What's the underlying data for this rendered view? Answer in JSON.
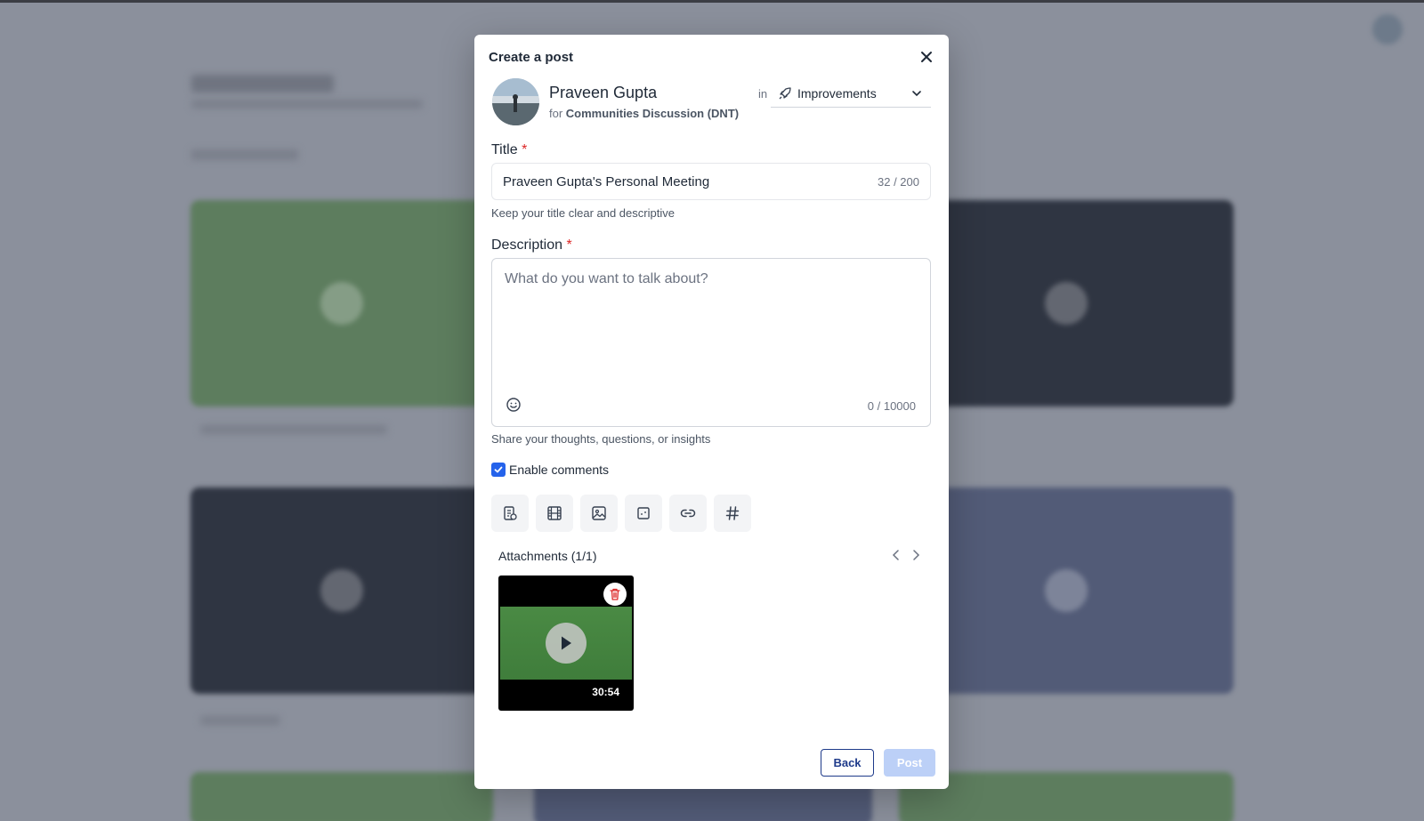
{
  "modal": {
    "title": "Create a post",
    "author": {
      "name": "Praveen Gupta",
      "for_prefix": "for",
      "community": "Communities Discussion (DNT)"
    },
    "in_label": "in",
    "category": "Improvements",
    "title_field": {
      "label": "Title",
      "required_mark": "*",
      "value": "Praveen Gupta's Personal Meeting",
      "counter": "32 / 200",
      "help": "Keep your title clear and descriptive"
    },
    "description_field": {
      "label": "Description",
      "required_mark": "*",
      "placeholder": "What do you want to talk about?",
      "counter": "0 / 10000",
      "help": "Share your thoughts, questions, or insights"
    },
    "enable_comments": {
      "label": "Enable comments",
      "checked": true
    },
    "toolbar": [
      "document-icon",
      "video-icon",
      "image-icon",
      "poll-icon",
      "link-icon",
      "hashtag-icon"
    ],
    "attachments": {
      "title": "Attachments (1/1)",
      "items": [
        {
          "duration": "30:54"
        }
      ]
    },
    "buttons": {
      "back": "Back",
      "post": "Post"
    }
  },
  "colors": {
    "primary": "#2563eb",
    "back_border": "#1e3a8a",
    "post_disabled": "#bcd0f7",
    "required": "#dc2626",
    "delete": "#dc2626",
    "overlay_bg": "#8b909c"
  }
}
